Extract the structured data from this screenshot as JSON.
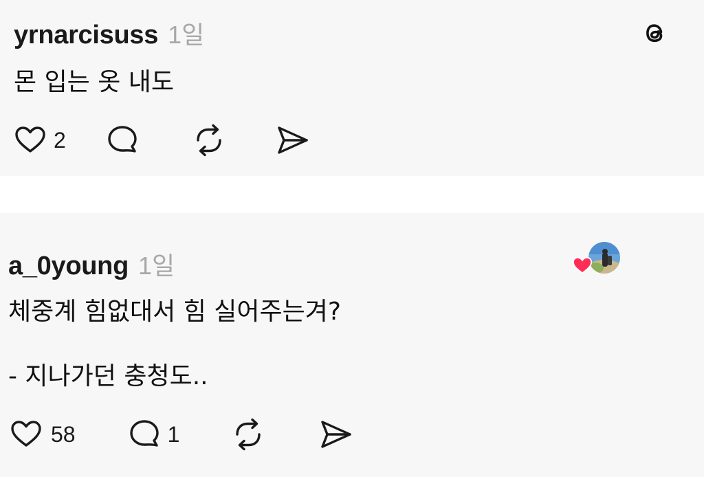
{
  "posts": [
    {
      "username": "yrnarcisuss",
      "time": "1일",
      "lines": [
        "몬 입는 옷 내도"
      ],
      "likes": "2",
      "replies": "",
      "corner_icon": "threads-logo-icon"
    },
    {
      "username": "a_0young",
      "time": "1일",
      "lines": [
        "체중계 힘없대서 힘 실어주는겨?",
        "- 지나가던 충청도.."
      ],
      "likes": "58",
      "replies": "1",
      "corner_icon": "avatar-with-liked-heart",
      "liked_heart_color": "#ff2d55"
    }
  ],
  "icons": {
    "like": "heart-outline-icon",
    "reply": "speech-bubble-icon",
    "repost": "repost-arrows-icon",
    "share": "send-paper-plane-icon"
  },
  "colors": {
    "post_background": "#f7f7f7",
    "separator_background": "#ffffff",
    "text": "#111111",
    "timestamp": "#a8a8a8",
    "heart_red": "#ff2d55"
  }
}
